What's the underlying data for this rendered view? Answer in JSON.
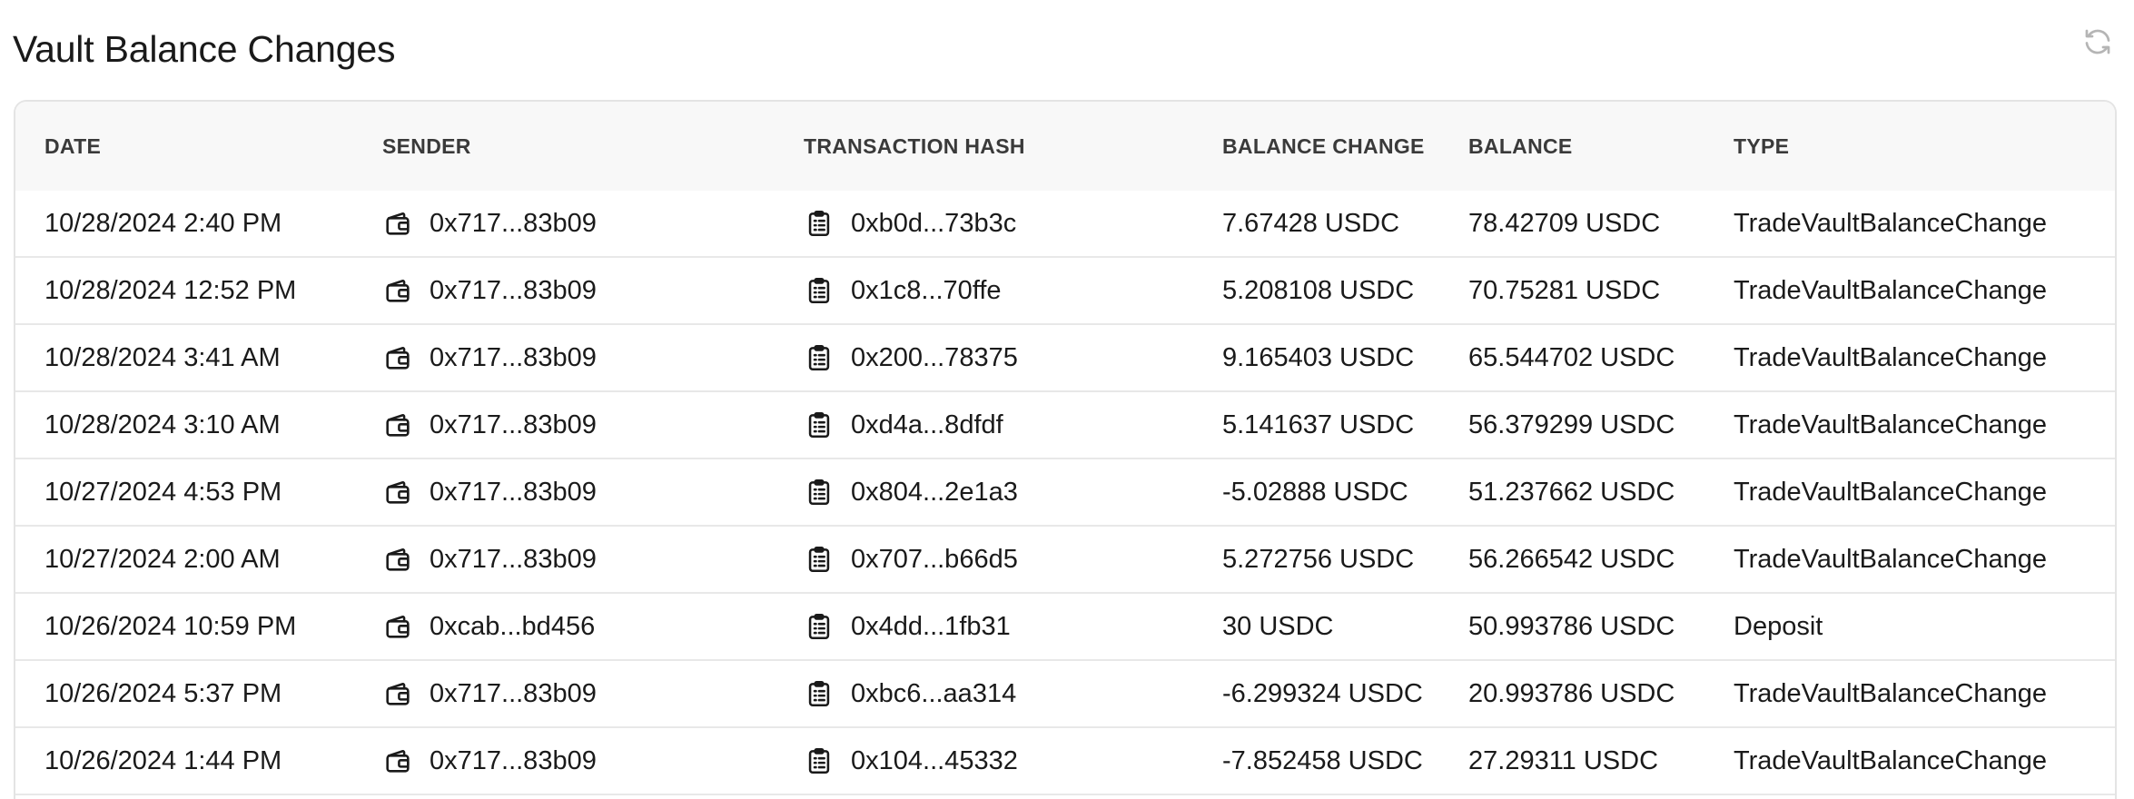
{
  "page": {
    "title": "Vault Balance Changes"
  },
  "icons": {
    "refresh": "refresh-icon",
    "sender": "wallet-icon",
    "hash": "clipboard-list-icon"
  },
  "colors": {
    "text": "#1a1a1a",
    "header_bg": "#f8f8f8",
    "border": "#e4e4e4",
    "icon_muted": "#b5b5b5"
  },
  "table": {
    "headers": {
      "date": "DATE",
      "sender": "SENDER",
      "hash": "TRANSACTION HASH",
      "change": "BALANCE CHANGE",
      "balance": "BALANCE",
      "type": "TYPE"
    },
    "rows": [
      {
        "date": "10/28/2024 2:40 PM",
        "sender": "0x717...83b09",
        "hash": "0xb0d...73b3c",
        "change": "7.67428 USDC",
        "balance": "78.42709 USDC",
        "type": "TradeVaultBalanceChange"
      },
      {
        "date": "10/28/2024 12:52 PM",
        "sender": "0x717...83b09",
        "hash": "0x1c8...70ffe",
        "change": "5.208108 USDC",
        "balance": "70.75281 USDC",
        "type": "TradeVaultBalanceChange"
      },
      {
        "date": "10/28/2024 3:41 AM",
        "sender": "0x717...83b09",
        "hash": "0x200...78375",
        "change": "9.165403 USDC",
        "balance": "65.544702 USDC",
        "type": "TradeVaultBalanceChange"
      },
      {
        "date": "10/28/2024 3:10 AM",
        "sender": "0x717...83b09",
        "hash": "0xd4a...8dfdf",
        "change": "5.141637 USDC",
        "balance": "56.379299 USDC",
        "type": "TradeVaultBalanceChange"
      },
      {
        "date": "10/27/2024 4:53 PM",
        "sender": "0x717...83b09",
        "hash": "0x804...2e1a3",
        "change": "-5.02888 USDC",
        "balance": "51.237662 USDC",
        "type": "TradeVaultBalanceChange"
      },
      {
        "date": "10/27/2024 2:00 AM",
        "sender": "0x717...83b09",
        "hash": "0x707...b66d5",
        "change": "5.272756 USDC",
        "balance": "56.266542 USDC",
        "type": "TradeVaultBalanceChange"
      },
      {
        "date": "10/26/2024 10:59 PM",
        "sender": "0xcab...bd456",
        "hash": "0x4dd...1fb31",
        "change": "30 USDC",
        "balance": "50.993786 USDC",
        "type": "Deposit"
      },
      {
        "date": "10/26/2024 5:37 PM",
        "sender": "0x717...83b09",
        "hash": "0xbc6...aa314",
        "change": "-6.299324 USDC",
        "balance": "20.993786 USDC",
        "type": "TradeVaultBalanceChange"
      },
      {
        "date": "10/26/2024 1:44 PM",
        "sender": "0x717...83b09",
        "hash": "0x104...45332",
        "change": "-7.852458 USDC",
        "balance": "27.29311 USDC",
        "type": "TradeVaultBalanceChange"
      }
    ]
  }
}
